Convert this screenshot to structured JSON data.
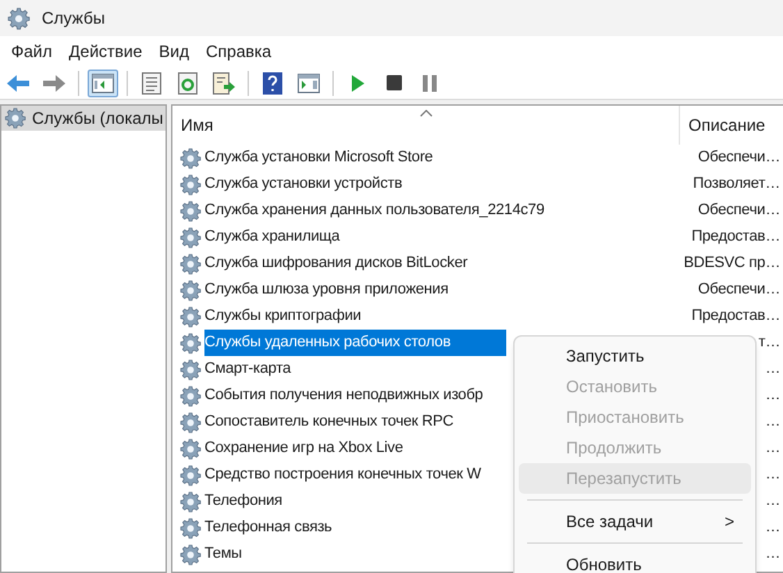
{
  "window": {
    "title": "Службы"
  },
  "menu_bar": [
    "Файл",
    "Действие",
    "Вид",
    "Справка"
  ],
  "toolbar": [
    {
      "kind": "back",
      "selected": false
    },
    {
      "kind": "forward",
      "selected": false
    },
    {
      "kind": "separator"
    },
    {
      "kind": "tree",
      "selected": true
    },
    {
      "kind": "separator"
    },
    {
      "kind": "properties",
      "selected": false
    },
    {
      "kind": "refresh",
      "selected": false
    },
    {
      "kind": "export",
      "selected": false
    },
    {
      "kind": "separator"
    },
    {
      "kind": "help",
      "selected": false
    },
    {
      "kind": "pane",
      "selected": false
    },
    {
      "kind": "separator"
    },
    {
      "kind": "play",
      "selected": false
    },
    {
      "kind": "stop",
      "selected": false
    },
    {
      "kind": "pause",
      "selected": false
    }
  ],
  "tree": {
    "items": [
      {
        "label": "Службы (локалы",
        "selected": true
      }
    ]
  },
  "table": {
    "columns": [
      "Имя",
      "Описание"
    ],
    "rows": [
      {
        "name": "Служба установки Microsoft Store",
        "description": "Обеспечи…",
        "selected": false
      },
      {
        "name": "Служба установки устройств",
        "description": "Позволяет…",
        "selected": false
      },
      {
        "name": "Служба хранения данных пользователя_2214c79",
        "description": "Обеспечи…",
        "selected": false
      },
      {
        "name": "Служба хранилища",
        "description": "Предостав…",
        "selected": false
      },
      {
        "name": "Служба шифрования дисков BitLocker",
        "description": "BDESVC пр…",
        "selected": false
      },
      {
        "name": "Служба шлюза уровня приложения",
        "description": "Обеспечи…",
        "selected": false
      },
      {
        "name": "Службы криптографии",
        "description": "Предостав…",
        "selected": false
      },
      {
        "name": "Службы удаленных рабочих столов",
        "description": "т…",
        "selected": true
      },
      {
        "name": "Смарт-карта",
        "description": "…",
        "selected": false
      },
      {
        "name": "События получения неподвижных изобр",
        "description": "…",
        "selected": false
      },
      {
        "name": "Сопоставитель конечных точек RPC",
        "description": "…",
        "selected": false
      },
      {
        "name": "Сохранение игр на Xbox Live",
        "description": "…",
        "selected": false
      },
      {
        "name": "Средство построения конечных точек W",
        "description": "…",
        "selected": false
      },
      {
        "name": "Телефония",
        "description": "…",
        "selected": false
      },
      {
        "name": "Телефонная связь",
        "description": "…",
        "selected": false
      },
      {
        "name": "Темы",
        "description": "…",
        "selected": false
      }
    ]
  },
  "context_menu": [
    {
      "kind": "item",
      "label": "Запустить",
      "disabled": false,
      "highlighted": false
    },
    {
      "kind": "item",
      "label": "Остановить",
      "disabled": true,
      "highlighted": false
    },
    {
      "kind": "item",
      "label": "Приостановить",
      "disabled": true,
      "highlighted": false
    },
    {
      "kind": "item",
      "label": "Продолжить",
      "disabled": true,
      "highlighted": false
    },
    {
      "kind": "item",
      "label": "Перезапустить",
      "disabled": true,
      "highlighted": true
    },
    {
      "kind": "separator"
    },
    {
      "kind": "submenu",
      "label": "Все задачи",
      "arrow": ">",
      "disabled": false,
      "highlighted": false
    },
    {
      "kind": "separator"
    },
    {
      "kind": "item",
      "label": "Обновить",
      "disabled": false,
      "highlighted": false
    }
  ]
}
